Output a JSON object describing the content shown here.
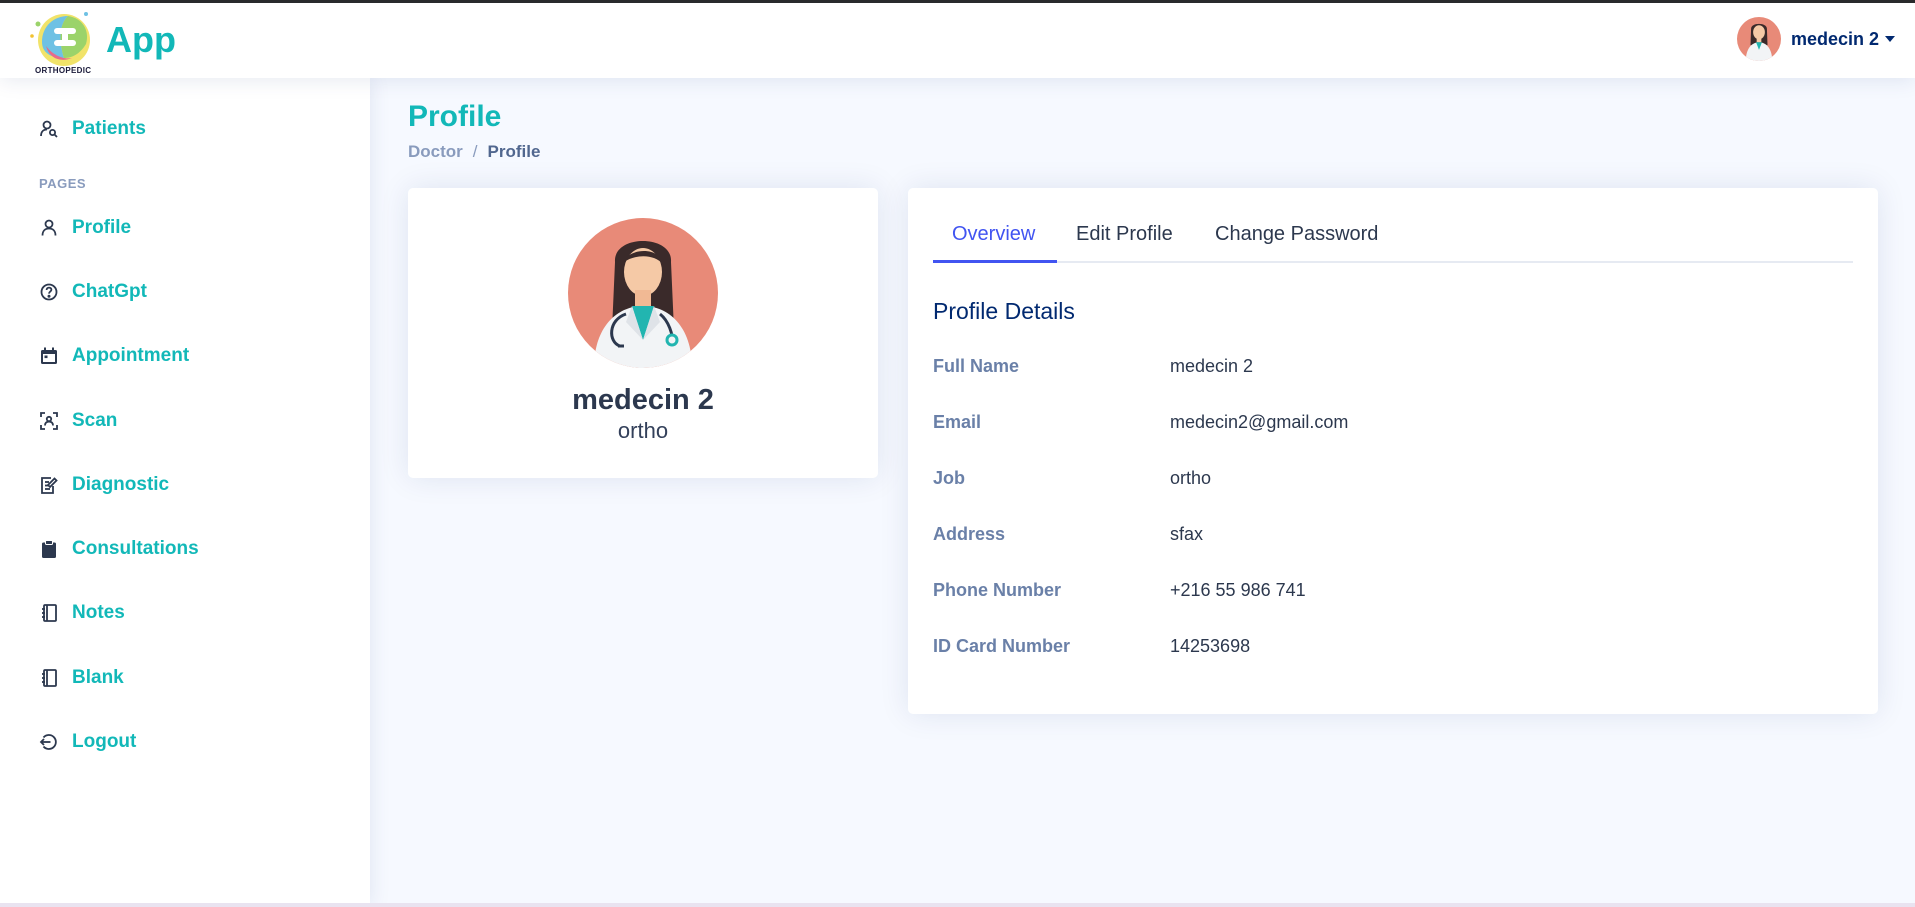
{
  "app": {
    "logo_text": "App",
    "logo_sub": "ORTHOPEDIC"
  },
  "header": {
    "user_name": "medecin 2"
  },
  "sidebar": {
    "heading_pages": "PAGES",
    "items": [
      {
        "label": "Patients",
        "icon": "person-search-icon"
      },
      {
        "label": "Profile",
        "icon": "person-icon"
      },
      {
        "label": "ChatGpt",
        "icon": "question-circle-icon"
      },
      {
        "label": "Appointment",
        "icon": "calendar-icon"
      },
      {
        "label": "Scan",
        "icon": "scan-icon"
      },
      {
        "label": "Diagnostic",
        "icon": "edit-document-icon"
      },
      {
        "label": "Consultations",
        "icon": "clipboard-icon"
      },
      {
        "label": "Notes",
        "icon": "journal-icon"
      },
      {
        "label": "Blank",
        "icon": "journal-icon"
      },
      {
        "label": "Logout",
        "icon": "logout-icon"
      }
    ]
  },
  "page": {
    "title": "Profile",
    "breadcrumb": [
      "Doctor",
      "Profile"
    ]
  },
  "profile_card": {
    "name": "medecin 2",
    "job": "ortho"
  },
  "tabs": [
    "Overview",
    "Edit Profile",
    "Change Password"
  ],
  "details": {
    "title": "Profile Details",
    "rows": [
      {
        "label": "Full Name",
        "value": "medecin 2"
      },
      {
        "label": "Email",
        "value": "medecin2@gmail.com"
      },
      {
        "label": "Job",
        "value": "ortho"
      },
      {
        "label": "Address",
        "value": "sfax"
      },
      {
        "label": "Phone Number",
        "value": "+216 55 986 741"
      },
      {
        "label": "ID Card Number",
        "value": "14253698"
      }
    ]
  },
  "colors": {
    "accent": "#12b8b8",
    "tab_active": "#4154f1",
    "navy": "#012970",
    "avatar_bg": "#e88a78"
  }
}
